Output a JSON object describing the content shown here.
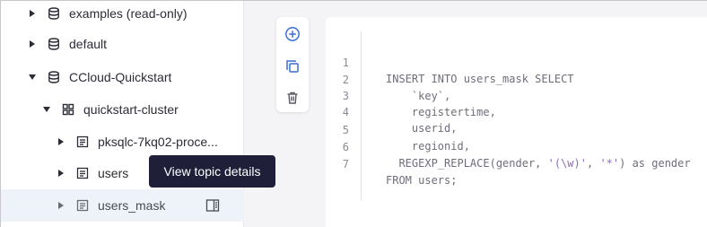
{
  "tree": {
    "items": [
      {
        "label": "examples (read-only)",
        "icon": "database-icon",
        "expanded": false
      },
      {
        "label": "default",
        "icon": "database-icon",
        "expanded": false
      },
      {
        "label": "CCloud-Quickstart",
        "icon": "database-icon",
        "expanded": true
      },
      {
        "label": "quickstart-cluster",
        "icon": "cluster-icon",
        "expanded": true
      },
      {
        "label": "pksqlc-7kq02-proce...",
        "icon": "topic-icon",
        "expanded": false
      },
      {
        "label": "users",
        "icon": "topic-icon",
        "expanded": false
      },
      {
        "label": "users_mask",
        "icon": "topic-icon",
        "expanded": false,
        "selected": true
      }
    ]
  },
  "tooltip": {
    "text": "View topic details"
  },
  "toolbar": {
    "icons": [
      "add-circle-icon",
      "duplicate-icon",
      "trash-icon"
    ]
  },
  "editor": {
    "lines": [
      {
        "n": "1",
        "text": "INSERT INTO users_mask SELECT"
      },
      {
        "n": "2",
        "text": "    `key`,"
      },
      {
        "n": "3",
        "text": "    registertime,"
      },
      {
        "n": "4",
        "text": "    userid,"
      },
      {
        "n": "5",
        "text": "    regionid,"
      },
      {
        "n": "6",
        "pre": "  REGEXP_REPLACE(gender, ",
        "s1": "'(\\w)'",
        "mid": ", ",
        "s2": "'*'",
        "post": ") as gender"
      },
      {
        "n": "7",
        "text": "FROM users;"
      }
    ]
  },
  "colors": {
    "selected_row": "#eef3fa",
    "tooltip_bg": "#1f1f3a",
    "accent": "#3b6fd4",
    "string": "#8b6bb8"
  }
}
